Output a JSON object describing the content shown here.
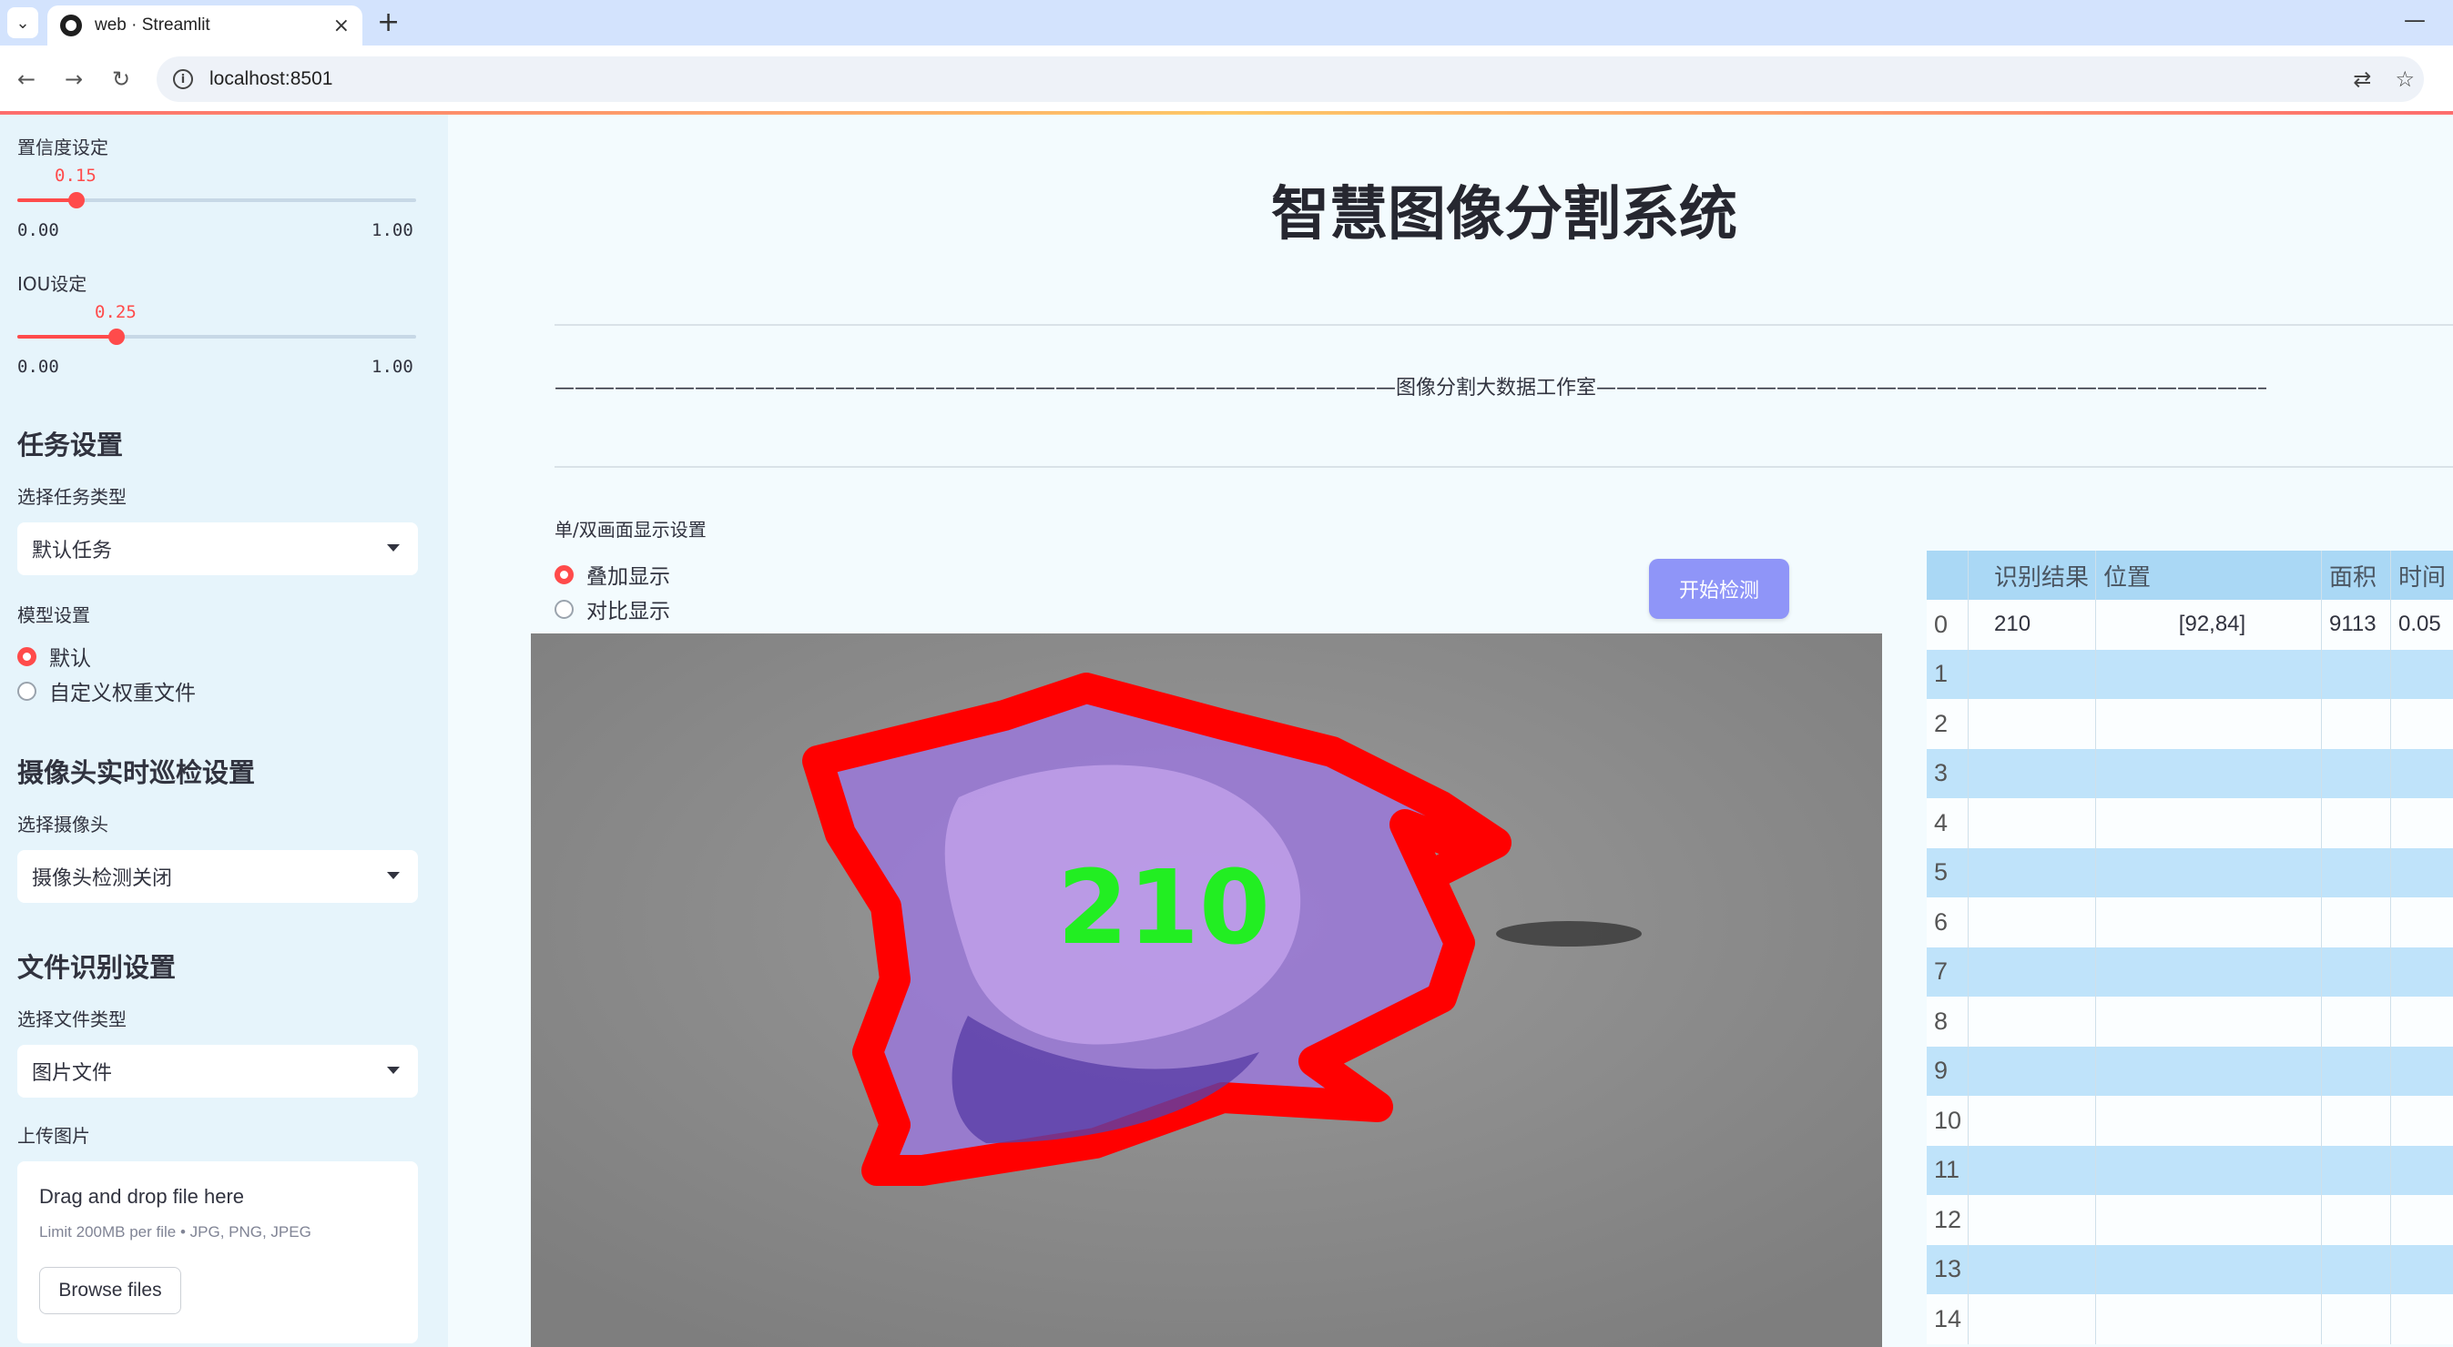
{
  "browser": {
    "tab_title": "web · Streamlit",
    "tab_close": "×",
    "new_tab": "+",
    "url": "localhost:8501",
    "menu_icon": "chevron-down-icon",
    "minimize": "—"
  },
  "sidebar": {
    "confidence": {
      "label": "置信度设定",
      "value": "0.15",
      "min": "0.00",
      "max": "1.00",
      "fraction": 0.15
    },
    "iou": {
      "label": "IOU设定",
      "value": "0.25",
      "min": "0.00",
      "max": "1.00",
      "fraction": 0.25
    },
    "task": {
      "heading": "任务设置",
      "select_label": "选择任务类型",
      "selected": "默认任务"
    },
    "model": {
      "label": "模型设置",
      "options": [
        "默认",
        "自定义权重文件"
      ],
      "selected_index": 0
    },
    "camera": {
      "heading": "摄像头实时巡检设置",
      "select_label": "选择摄像头",
      "selected": "摄像头检测关闭"
    },
    "file": {
      "heading": "文件识别设置",
      "select_label": "选择文件类型",
      "selected": "图片文件"
    },
    "upload": {
      "label": "上传图片",
      "drag_text": "Drag and drop file here",
      "limit_text": "Limit 200MB per file • JPG, PNG, JPEG",
      "browse_label": "Browse files"
    }
  },
  "main": {
    "title": "智慧图像分割系统",
    "divider_text": "——————————————————————————————————————————图像分割大数据工作室——————————————————————————————————————————",
    "display_label": "单/双画面显示设置",
    "display_options": [
      "叠加显示",
      "对比显示"
    ],
    "display_selected_index": 0,
    "start_button": "开始检测",
    "detection_label": "210"
  },
  "table": {
    "headers": [
      "",
      "识别结果",
      "位置",
      "面积",
      "时间"
    ],
    "rows": [
      [
        "0",
        "210",
        "[92,84]",
        "9113",
        "0.05"
      ],
      [
        "1",
        "",
        "",
        "",
        ""
      ],
      [
        "2",
        "",
        "",
        "",
        ""
      ],
      [
        "3",
        "",
        "",
        "",
        ""
      ],
      [
        "4",
        "",
        "",
        "",
        ""
      ],
      [
        "5",
        "",
        "",
        "",
        ""
      ],
      [
        "6",
        "",
        "",
        "",
        ""
      ],
      [
        "7",
        "",
        "",
        "",
        ""
      ],
      [
        "8",
        "",
        "",
        "",
        ""
      ],
      [
        "9",
        "",
        "",
        "",
        ""
      ],
      [
        "10",
        "",
        "",
        "",
        ""
      ],
      [
        "11",
        "",
        "",
        "",
        ""
      ],
      [
        "12",
        "",
        "",
        "",
        ""
      ],
      [
        "13",
        "",
        "",
        "",
        ""
      ],
      [
        "14",
        "",
        "",
        "",
        ""
      ]
    ]
  },
  "colors": {
    "accent": "#ff4b4b",
    "sidebar_bg": "#e6f4fb",
    "main_bg": "#f3fbfe",
    "button": "#8f95f8",
    "table_head": "#aad8f5",
    "table_stripe": "#bfe3fa",
    "mask_outline": "#ff0000",
    "mask_fill": "#9b7cd8",
    "label_text": "#22ee22"
  }
}
